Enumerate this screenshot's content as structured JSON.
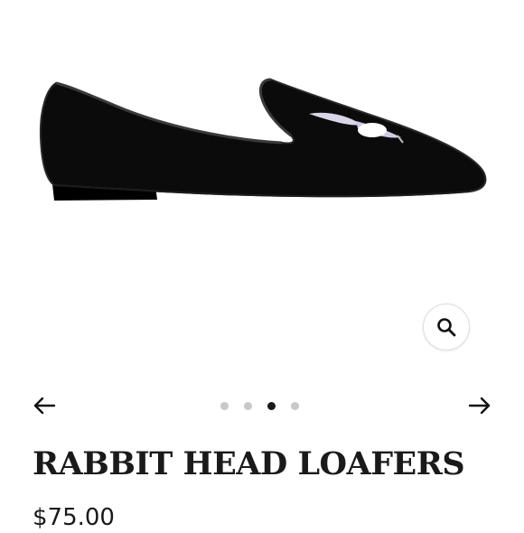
{
  "product": {
    "title": "RABBIT HEAD LOAFERS",
    "price": "$75.00",
    "image_alt": "black velvet loafer with rabbit head embroidery"
  },
  "gallery": {
    "slide_count": 4,
    "active_index": 2
  },
  "icons": {
    "zoom": "magnifier-icon",
    "prev": "arrow-left-icon",
    "next": "arrow-right-icon"
  },
  "colors": {
    "shoe": "#0b0b0b",
    "text": "#1a1a1a",
    "dot_inactive": "#c8c8c8",
    "dot_active": "#1a1a1a"
  }
}
